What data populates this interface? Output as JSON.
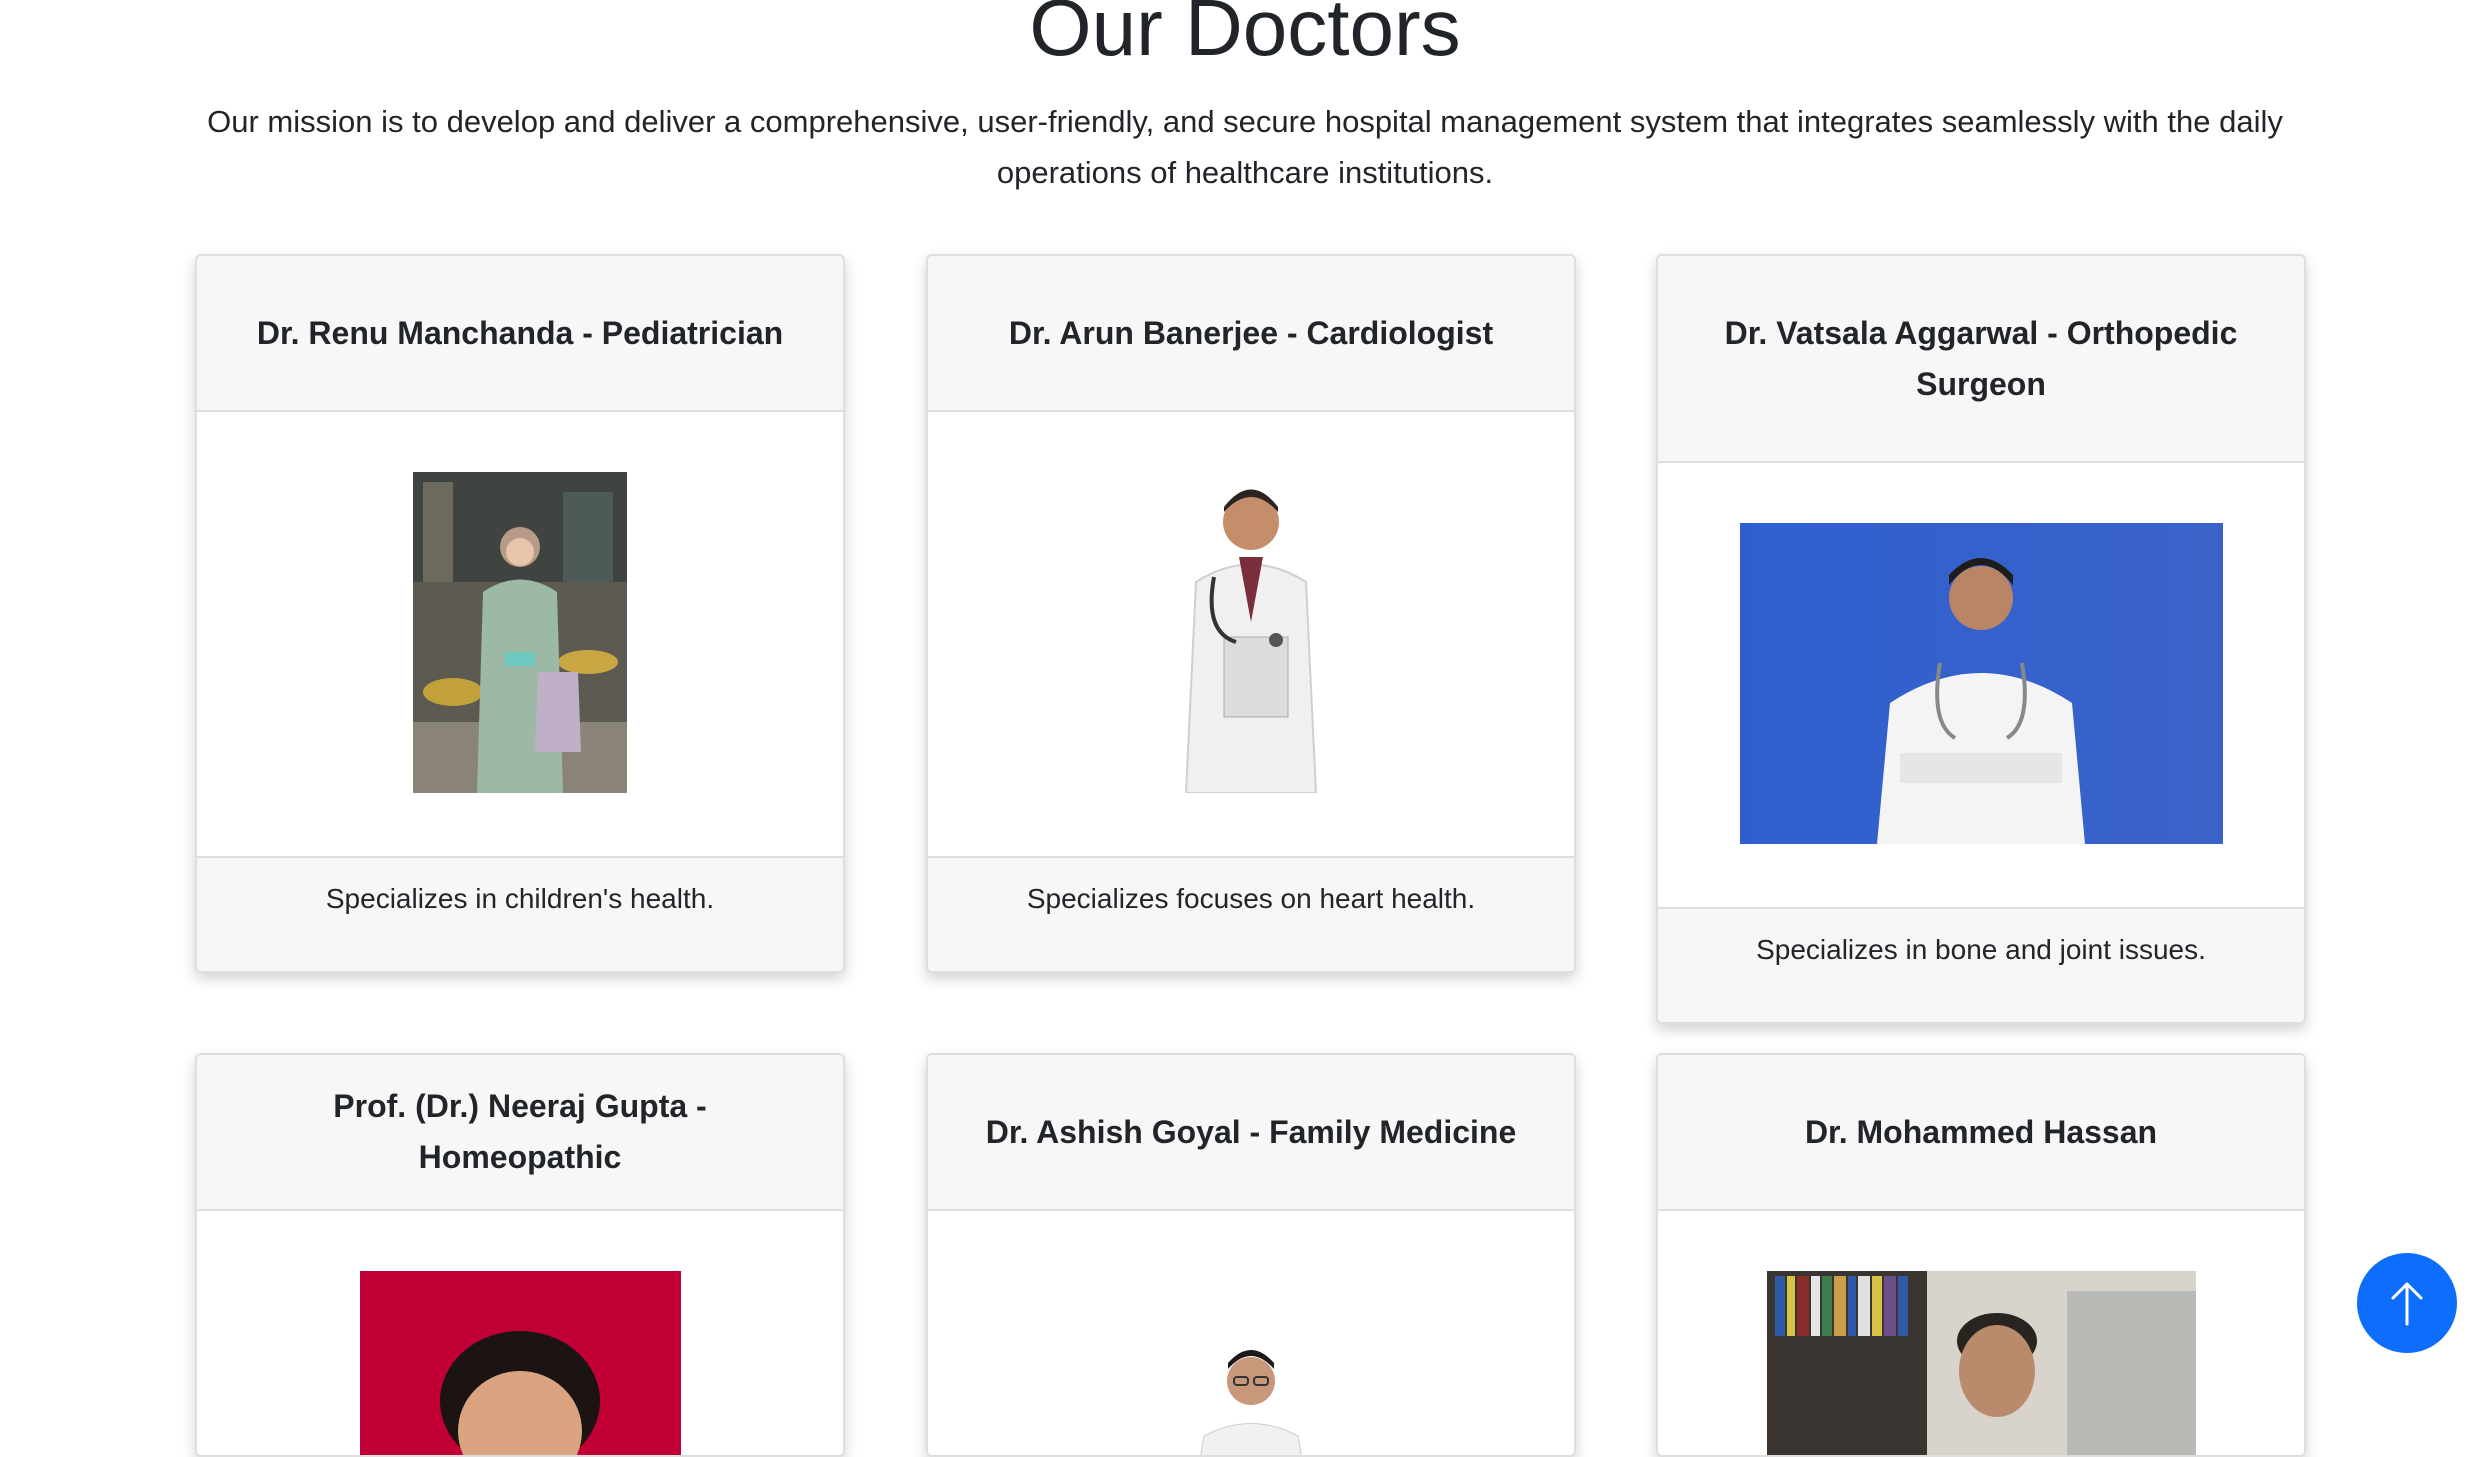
{
  "page": {
    "title": "Our Doctors",
    "mission": "Our mission is to develop and deliver a comprehensive, user-friendly, and secure hospital management system that integrates seamlessly with the daily operations of healthcare institutions."
  },
  "doctors": [
    {
      "name": "Dr. Renu Manchanda - Pediatrician",
      "description": "Specializes in children's health."
    },
    {
      "name": "Dr. Arun Banerjee - Cardiologist",
      "description": "Specializes focuses on heart health."
    },
    {
      "name": "Dr. Vatsala Aggarwal - Orthopedic Surgeon",
      "description": "Specializes in bone and joint issues."
    },
    {
      "name": "Prof. (Dr.) Neeraj Gupta - Homeopathic",
      "description": ""
    },
    {
      "name": "Dr. Ashish Goyal - Family Medicine",
      "description": ""
    },
    {
      "name": "Dr. Mohammed Hassan",
      "description": ""
    }
  ],
  "colors": {
    "accent": "#0d6efd",
    "card_header_bg": "#f7f7f7",
    "text": "#212529"
  },
  "icons": {
    "scroll_top": "arrow-up-icon"
  }
}
